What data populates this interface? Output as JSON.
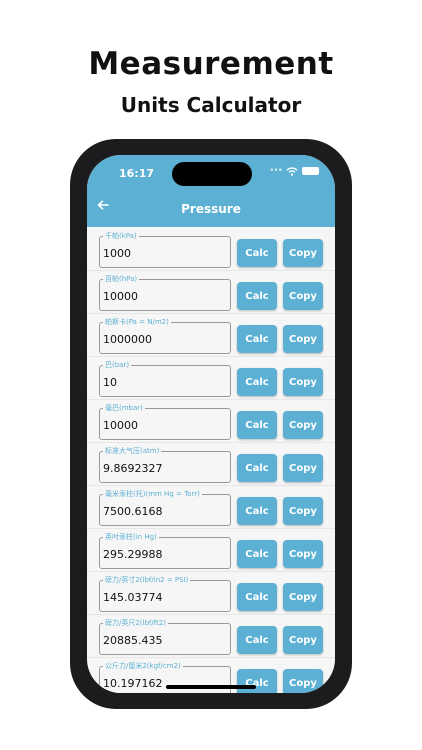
{
  "promo": {
    "title": "Measurement",
    "subtitle": "Units Calculator"
  },
  "status": {
    "time": "16:17",
    "dots": "•••"
  },
  "appbar": {
    "back_icon": "arrow-left-icon",
    "title": "Pressure"
  },
  "buttons": {
    "calc_label": "Calc",
    "copy_label": "Copy"
  },
  "units": [
    {
      "label": "千帕(kPa)",
      "value": "1000"
    },
    {
      "label": "百帕(hPa)",
      "value": "10000"
    },
    {
      "label": "帕斯卡(Pa = N/m2)",
      "value": "1000000"
    },
    {
      "label": "巴(bar)",
      "value": "10"
    },
    {
      "label": "毫巴(mbar)",
      "value": "10000"
    },
    {
      "label": "标准大气压(atm)",
      "value": "9.8692327"
    },
    {
      "label": "毫米汞柱(托)(mm Hg = Torr)",
      "value": "7500.6168"
    },
    {
      "label": "英吋汞柱(in Hg)",
      "value": "295.29988"
    },
    {
      "label": "磅力/英寸2(lbf/in2 = PSI)",
      "value": "145.03774"
    },
    {
      "label": "磅力/英尺2(lbf/ft2)",
      "value": "20885.435"
    },
    {
      "label": "公斤力/厘米2(kgf/cm2)",
      "value": "10.197162"
    }
  ],
  "colors": {
    "accent": "#5bb0d3",
    "phone_frame": "#1c1c1e"
  }
}
